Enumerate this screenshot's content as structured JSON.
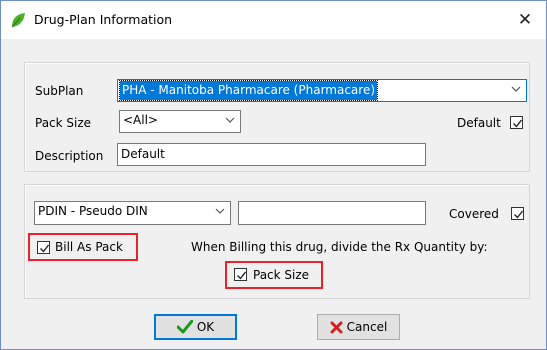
{
  "window": {
    "title": "Drug-Plan Information",
    "close_glyph": "✕",
    "icon": "leaf-icon"
  },
  "plan": {
    "subplan_label": "SubPlan",
    "subplan_value": "PHA - Manitoba Pharmacare (Pharmacare)",
    "pack_size_label": "Pack Size",
    "pack_size_value": "<All>",
    "default_label": "Default",
    "default_checked": true,
    "description_label": "Description",
    "description_value": "Default"
  },
  "billing": {
    "code_type_value": "PDIN - Pseudo DIN",
    "code_value": "",
    "covered_label": "Covered",
    "covered_checked": true,
    "bill_as_pack_label": "Bill As Pack",
    "bill_as_pack_checked": true,
    "divide_text": "When Billing this drug, divide the Rx Quantity by:",
    "pack_size_label": "Pack Size",
    "pack_size_checked": true
  },
  "buttons": {
    "ok_label": "OK",
    "cancel_label": "Cancel"
  },
  "colors": {
    "accent": "#0078d7",
    "highlight_box": "#e8212d",
    "leaf": "#4caf2a",
    "ok_check": "#1a9a1a",
    "cancel_x": "#d21f1f"
  }
}
